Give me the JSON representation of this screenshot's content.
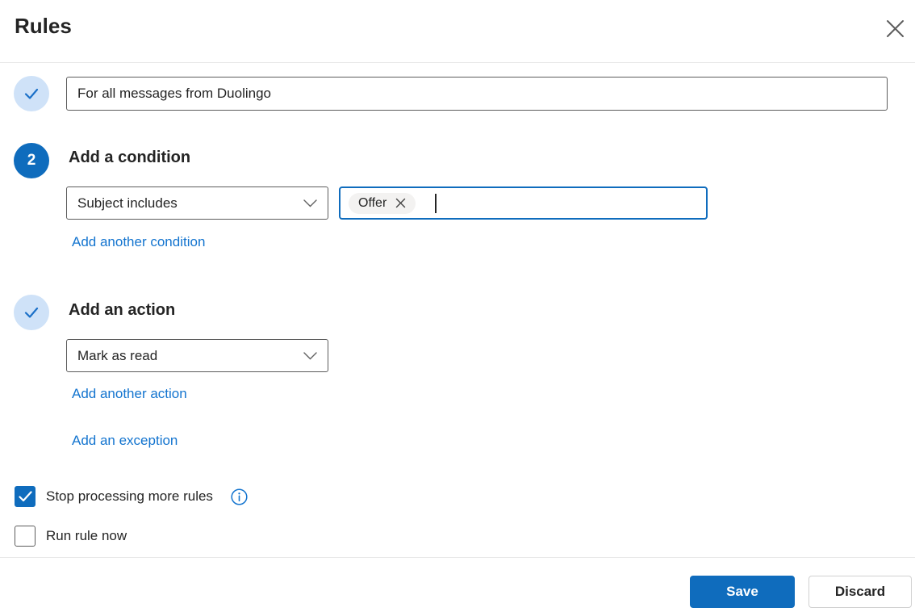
{
  "dialog": {
    "title": "Rules"
  },
  "colors": {
    "brand": "#0f6cbd",
    "link": "#1374cf",
    "step_done_bg": "#cfe2f8",
    "chip_bg": "#f3f2f1"
  },
  "rule": {
    "name": {
      "value": "For all messages from Duolingo"
    },
    "condition": {
      "step_number": "2",
      "heading": "Add a condition",
      "selected_option": "Subject includes",
      "value_chip": "Offer",
      "add_another_label": "Add another condition"
    },
    "action": {
      "heading": "Add an action",
      "selected_option": "Mark as read",
      "add_another_label": "Add another action",
      "add_exception_label": "Add an exception"
    },
    "options": [
      {
        "label": "Stop processing more rules",
        "checked": true,
        "info": true
      },
      {
        "label": "Run rule now",
        "checked": false
      }
    ]
  },
  "footer": {
    "save_label": "Save",
    "discard_label": "Discard"
  }
}
